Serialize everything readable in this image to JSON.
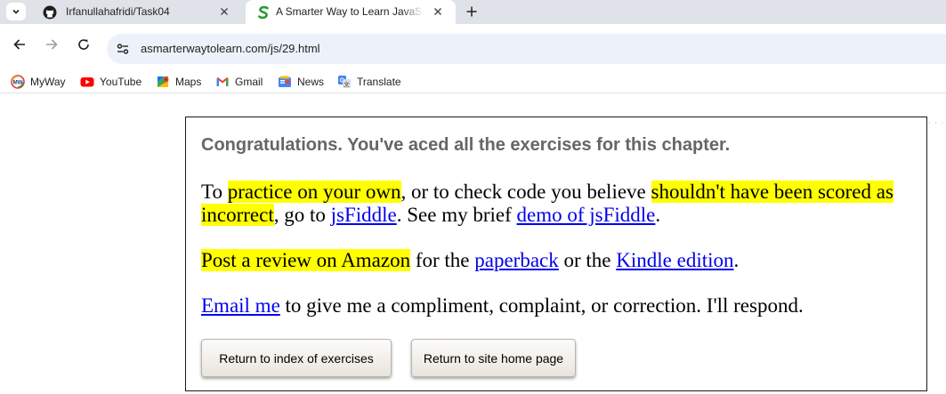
{
  "tabs": [
    {
      "title": "Irfanullahafridi/Task04",
      "icon": "github-icon",
      "active": false
    },
    {
      "title": "A Smarter Way to Learn JavaScript",
      "icon": "site-s-icon",
      "active": true
    }
  ],
  "address_bar": {
    "url": "asmarterwaytolearn.com/js/29.html"
  },
  "bookmarks": [
    {
      "label": "MyWay",
      "icon": "myway-icon"
    },
    {
      "label": "YouTube",
      "icon": "youtube-icon"
    },
    {
      "label": "Maps",
      "icon": "maps-icon"
    },
    {
      "label": "Gmail",
      "icon": "gmail-icon"
    },
    {
      "label": "News",
      "icon": "news-icon"
    },
    {
      "label": "Translate",
      "icon": "translate-icon"
    }
  ],
  "content": {
    "heading": "Congratulations. You've aced all the exercises for this chapter.",
    "p1": {
      "t1": "To ",
      "h1": "practice on your own",
      "t2": ", or to check code you believe ",
      "h2": "shouldn't have been scored as incorrect",
      "t3": ", go to ",
      "link1": "jsFiddle",
      "t4": ". See my brief ",
      "link2": "demo of jsFiddle",
      "t5": "."
    },
    "p2": {
      "h1": "Post a review on Amazon",
      "t1": " for the ",
      "link1": "paperback",
      "t2": " or the ",
      "link2": "Kindle edition",
      "t3": "."
    },
    "p3": {
      "link1": "Email me",
      "t1": " to give me a compliment, complaint, or correction. I'll respond."
    },
    "buttons": {
      "index": "Return to index of exercises",
      "home": "Return to site home page"
    }
  },
  "colors": {
    "highlight": "#ffff00",
    "link": "#0000ee",
    "heading": "#666666",
    "tabstrip": "#dfe3e9",
    "omnibox": "#edf2fa"
  }
}
